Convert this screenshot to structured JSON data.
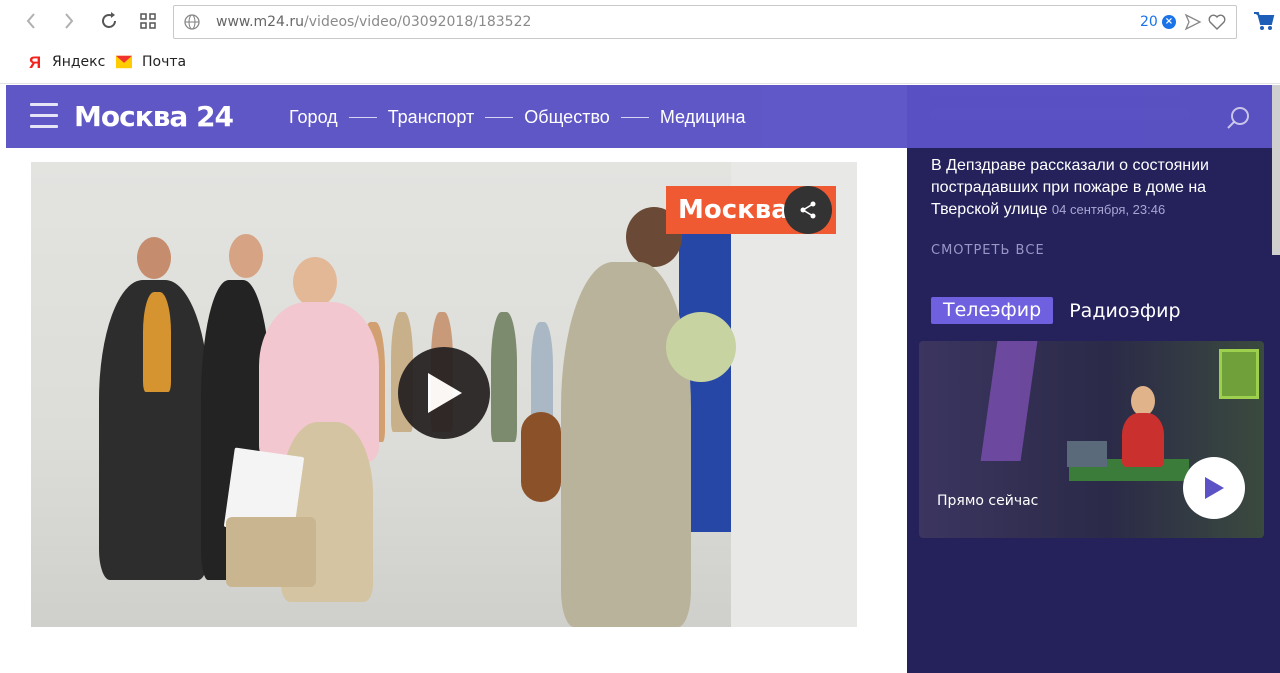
{
  "browser": {
    "url_host": "www.m24.ru",
    "url_path": "/videos/video/03092018/183522",
    "badge_count": "20",
    "bookmarks": [
      {
        "label": "Яндекс",
        "icon": "yandex-icon"
      },
      {
        "label": "Почта",
        "icon": "mail-icon"
      }
    ]
  },
  "site": {
    "logo": "Москва 24",
    "menu": [
      "Город",
      "Транспорт",
      "Общество",
      "Медицина"
    ]
  },
  "video": {
    "badge": "Москва"
  },
  "sidebar": {
    "news_title": "В Депздраве рассказали о состоянии пострадавших при пожаре в доме на Тверской улице",
    "news_date": "04 сентября, 23:46",
    "see_all": "СМОТРЕТЬ ВСЕ",
    "tabs": [
      "Телеэфир",
      "Радиоэфир"
    ],
    "live_caption": "Прямо сейчас"
  },
  "colors": {
    "header": "#5b52c6",
    "sidebar": "#24215b",
    "accent": "#6f60e0",
    "badge": "#ef5a32"
  }
}
